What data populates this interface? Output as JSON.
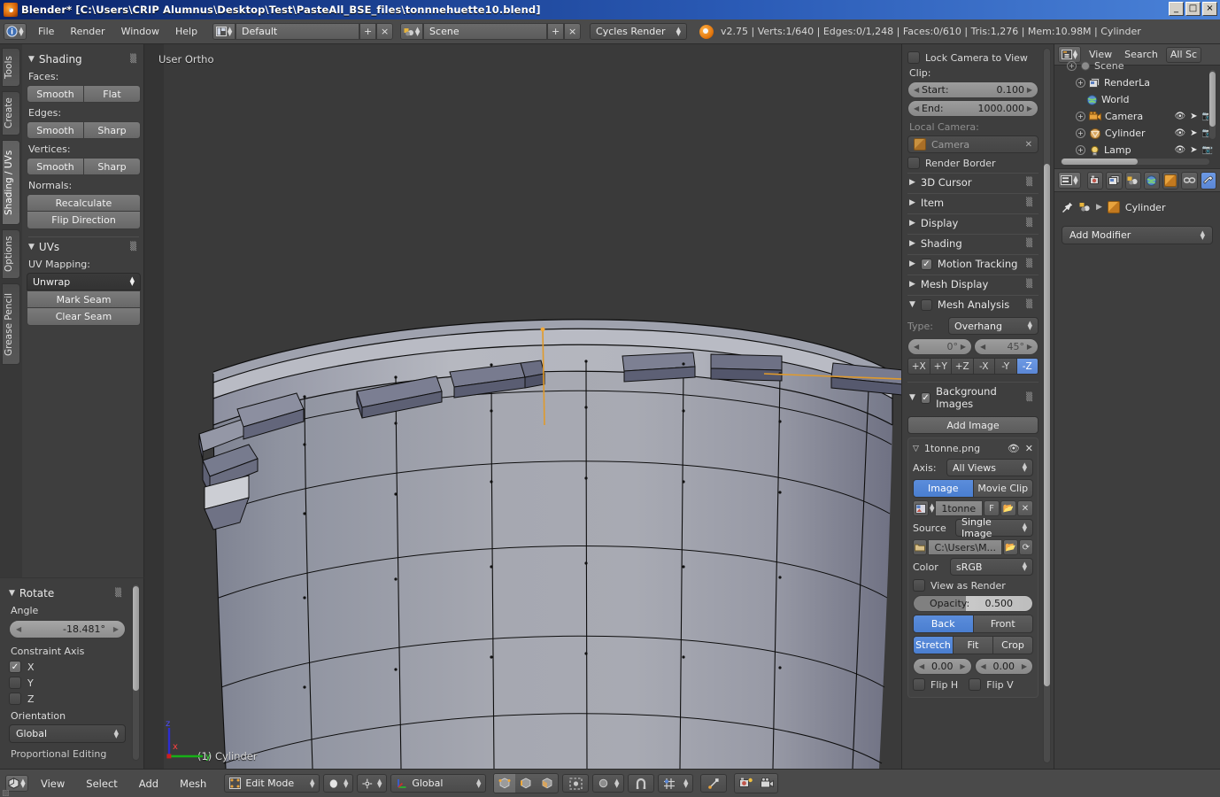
{
  "window": {
    "title": "Blender* [C:\\Users\\CRIP Alumnus\\Desktop\\Test\\PasteAll_BSE_files\\tonnnehuette10.blend]",
    "minimize": "_",
    "maximize": "□",
    "close": "×"
  },
  "info_header": {
    "menus": [
      "File",
      "Render",
      "Window",
      "Help"
    ],
    "screen_layout": "Default",
    "scene": "Scene",
    "engine": "Cycles Render",
    "add_label": "+",
    "remove_label": "×",
    "status": "v2.75 | Verts:1/640 | Edges:0/1,248 | Faces:0/610 | Tris:1,276 | Mem:10.98M | Cylinder"
  },
  "toolshelf": {
    "tabs": [
      "Tools",
      "Create",
      "Shading / UVs",
      "Options",
      "Grease Pencil"
    ],
    "active_tab": "Shading / UVs",
    "shading": {
      "title": "Shading",
      "faces_label": "Faces:",
      "faces": [
        "Smooth",
        "Flat"
      ],
      "edges_label": "Edges:",
      "edges": [
        "Smooth",
        "Sharp"
      ],
      "vertices_label": "Vertices:",
      "vertices": [
        "Smooth",
        "Sharp"
      ],
      "normals_label": "Normals:",
      "normals": [
        "Recalculate",
        "Flip Direction"
      ]
    },
    "uvs": {
      "title": "UVs",
      "mapping_label": "UV Mapping:",
      "unwrap": "Unwrap",
      "mark_seam": "Mark Seam",
      "clear_seam": "Clear Seam"
    }
  },
  "operator_panel": {
    "title": "Rotate",
    "angle_label": "Angle",
    "angle_value": "-18.481°",
    "constraint_label": "Constraint Axis",
    "axes": [
      {
        "label": "X",
        "checked": true
      },
      {
        "label": "Y",
        "checked": false
      },
      {
        "label": "Z",
        "checked": false
      }
    ],
    "orientation_label": "Orientation",
    "orientation_value": "Global",
    "proportional_label": "Proportional Editing"
  },
  "viewport": {
    "view_name": "User Ortho",
    "object_label": "(1) Cylinder",
    "axis_gizmo": {
      "z": "z",
      "x": "x",
      "y": "y"
    },
    "colors": {
      "background": "#3a3a3a",
      "mesh_light": "#a3a5ae",
      "mesh_dark": "#6d7084",
      "selection": "#e09a2b"
    }
  },
  "npanel": {
    "lock_camera_label": "Lock Camera to View",
    "clip_label": "Clip:",
    "clip_start_label": "Start:",
    "clip_start_value": "0.100",
    "clip_end_label": "End:",
    "clip_end_value": "1000.000",
    "local_camera_label": "Local Camera:",
    "local_camera_value": "Camera",
    "render_border_label": "Render Border",
    "sections": [
      {
        "label": "3D Cursor",
        "open": false,
        "check": null
      },
      {
        "label": "Item",
        "open": false,
        "check": null
      },
      {
        "label": "Display",
        "open": false,
        "check": null
      },
      {
        "label": "Shading",
        "open": false,
        "check": null
      },
      {
        "label": "Motion Tracking",
        "open": false,
        "check": true
      },
      {
        "label": "Mesh Display",
        "open": false,
        "check": null
      }
    ],
    "mesh_analysis": {
      "title": "Mesh Analysis",
      "enabled": false,
      "type_label": "Type:",
      "type_value": "Overhang",
      "min_angle": "0°",
      "max_angle": "45°",
      "axis_buttons": [
        "+X",
        "+Y",
        "+Z",
        "-X",
        "-Y",
        "-Z"
      ],
      "axis_active": "-Z"
    },
    "background_images": {
      "title": "Background Images",
      "enabled": true,
      "add_image_label": "Add Image",
      "image_name": "1tonne.png",
      "axis_label": "Axis:",
      "axis_value": "All Views",
      "source_toggle": [
        "Image",
        "Movie Clip"
      ],
      "source_toggle_active": "Image",
      "datablock_name": "1tonne",
      "fake_user_label": "F",
      "source_label": "Source",
      "source_value": "Single Image",
      "filepath": "C:\\Users\\M...",
      "color_label": "Color",
      "color_value": "sRGB",
      "view_as_render_label": "View as Render",
      "opacity_label": "Opacity:",
      "opacity_value": "0.500",
      "depth_toggle": [
        "Back",
        "Front"
      ],
      "depth_active": "Back",
      "frame_toggle": [
        "Stretch",
        "Fit",
        "Crop"
      ],
      "frame_active": "Stretch",
      "offset_x": "0.00",
      "offset_y": "0.00",
      "flip_h_label": "Flip H",
      "flip_v_label": "Flip V"
    }
  },
  "outliner": {
    "menus": [
      "View",
      "Search"
    ],
    "display_mode": "All Sc",
    "rows": [
      {
        "label": "Scene",
        "indent": 0,
        "icon": "scene-icon",
        "expandable": true
      },
      {
        "label": "RenderLa",
        "indent": 1,
        "icon": "renderlayers-icon",
        "expandable": true
      },
      {
        "label": "World",
        "indent": 1,
        "icon": "world-icon",
        "expandable": false
      },
      {
        "label": "Camera",
        "indent": 1,
        "icon": "camera-icon",
        "expandable": true
      },
      {
        "label": "Cylinder",
        "indent": 1,
        "icon": "mesh-icon",
        "expandable": true
      },
      {
        "label": "Lamp",
        "indent": 1,
        "icon": "lamp-icon",
        "expandable": true
      }
    ]
  },
  "properties": {
    "tabs": [
      "render-icon",
      "renderlayers-icon",
      "scene-icon",
      "world-icon",
      "object-icon",
      "constraints-icon",
      "modifier-icon"
    ],
    "active_tab": "modifier-icon",
    "breadcrumb_object": "Cylinder",
    "add_modifier_label": "Add Modifier"
  },
  "bottom_bar": {
    "menus": [
      "View",
      "Select",
      "Add",
      "Mesh"
    ],
    "mode": "Edit Mode",
    "orientation": "Global",
    "select_modes": [
      "vertex-select-icon",
      "edge-select-icon",
      "face-select-icon"
    ],
    "select_mode_active": "vertex-select-icon"
  }
}
